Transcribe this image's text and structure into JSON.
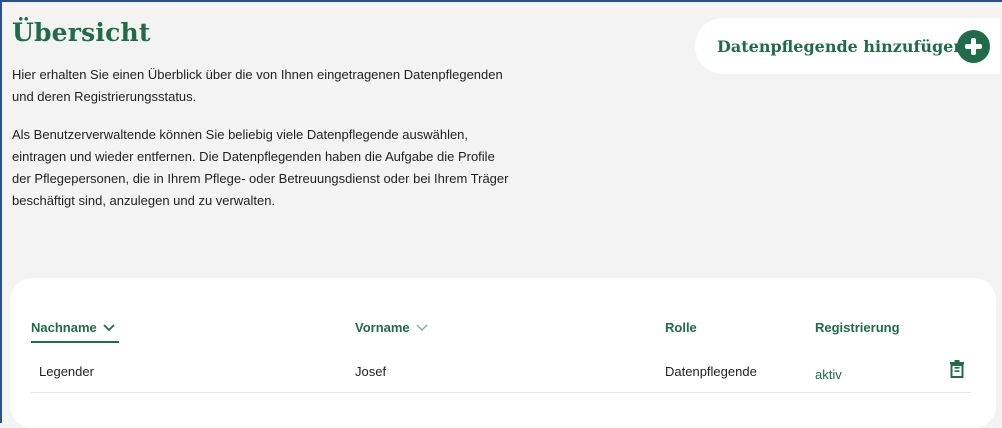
{
  "page": {
    "title": "Übersicht",
    "intro_paragraph_1": "Hier erhalten Sie einen Überblick über die von Ihnen eingetragenen Datenpflegenden und deren Registrierungsstatus.",
    "intro_paragraph_2": "Als Benutzerverwaltende können Sie beliebig viele Datenpflegende auswählen, eintragen und wieder entfernen. Die Datenpflegenden haben die Aufgabe die Profile der Pflegepersonen, die in Ihrem Pflege- oder Betreuungsdienst oder bei Ihrem Träger beschäftigt sind, anzulegen und zu verwalten."
  },
  "actions": {
    "add_label": "Datenpflegende hinzufügen",
    "add_icon": "plus-circle-icon"
  },
  "table": {
    "columns": [
      {
        "label": "Nachname",
        "sortable": true,
        "active": true,
        "icon": "chevron-down-icon"
      },
      {
        "label": "Vorname",
        "sortable": true,
        "active": false,
        "icon": "chevron-down-icon"
      },
      {
        "label": "Rolle",
        "sortable": false
      },
      {
        "label": "Registrierung",
        "sortable": false
      }
    ],
    "rows": [
      {
        "nachname": "Legender",
        "vorname": "Josef",
        "rolle": "Datenpflegende",
        "registrierung": "aktiv",
        "delete_icon": "trash-icon"
      }
    ]
  },
  "colors": {
    "accent": "#1f6b4a",
    "frame": "#2b4f8f",
    "background": "#f3f3f3"
  }
}
